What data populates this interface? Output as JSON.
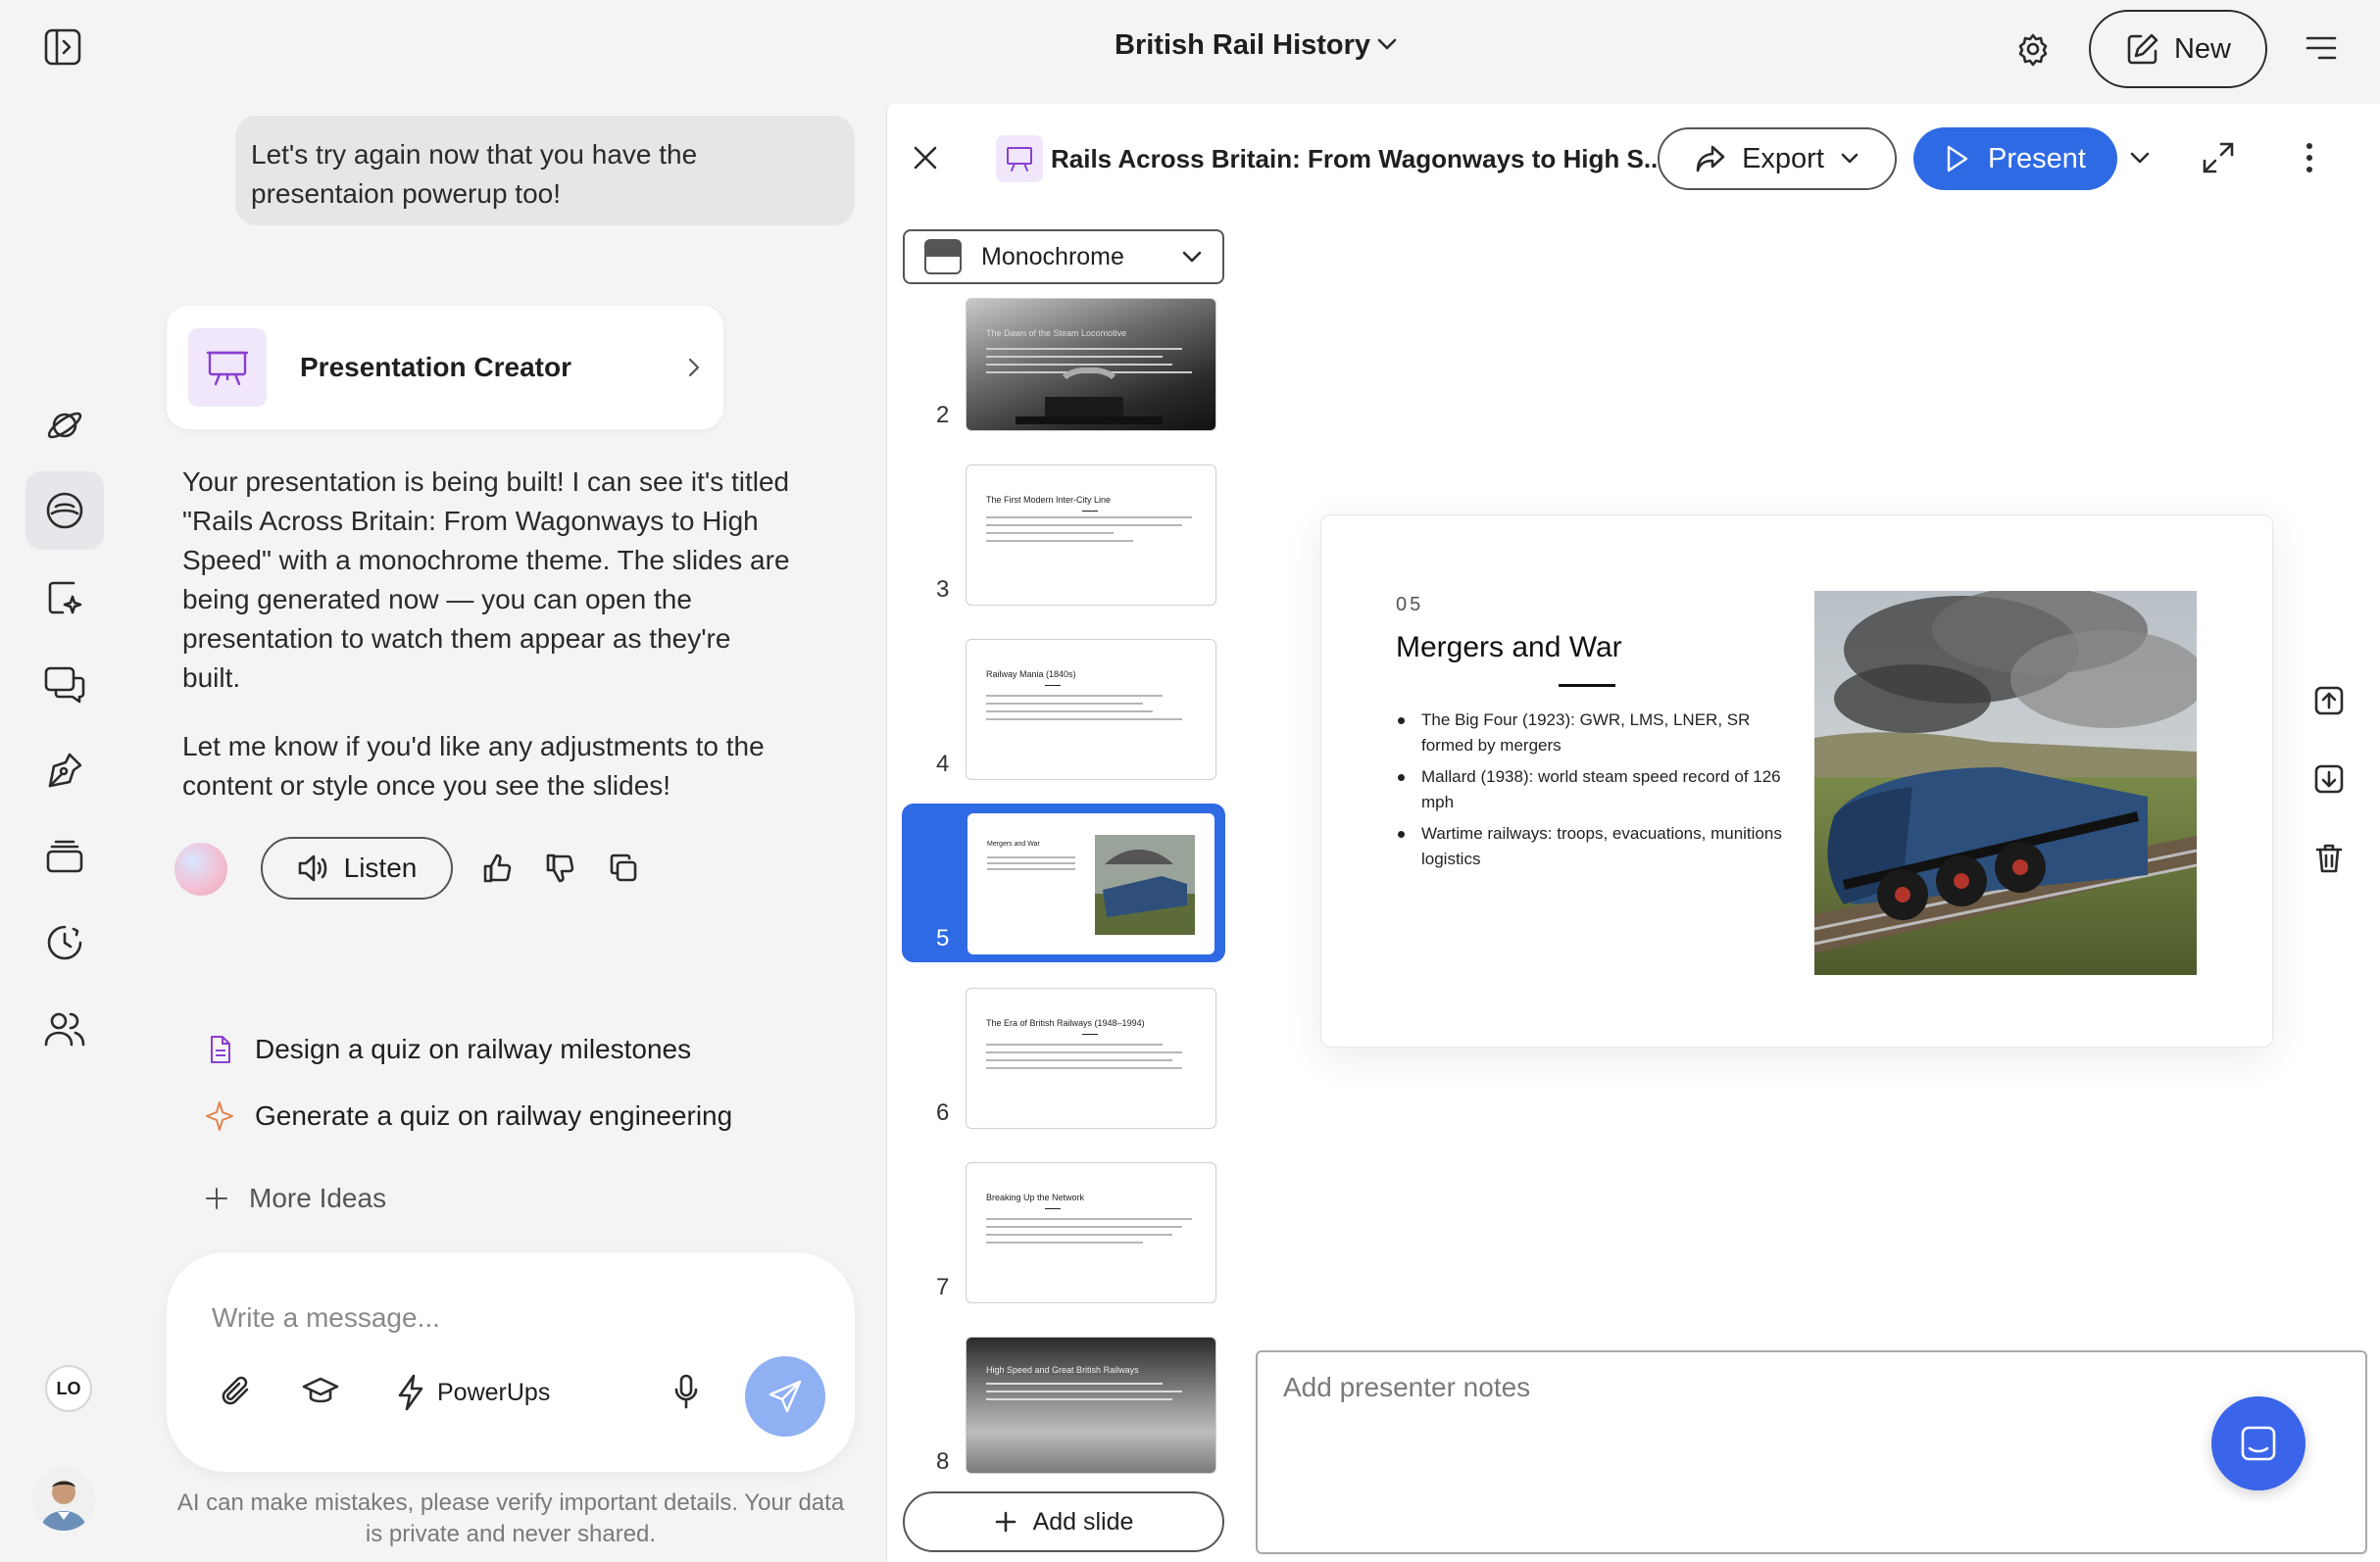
{
  "app": {
    "doc_title": "British Rail History",
    "new_label": "New",
    "user_initials": "LO"
  },
  "chat": {
    "user_message": "Let's try again now that you have the presentaion powerup too!",
    "tool_card_title": "Presentation Creator",
    "assistant_p1": "Your presentation is being built! I can see it's titled \"Rails Across Britain: From Wagonways to High Speed\" with a monochrome theme. The slides are being generated now — you can open the presentation to watch them appear as they're built.",
    "assistant_p2": "Let me know if you'd like any adjustments to the content or style once you see the slides!",
    "listen_label": "Listen",
    "suggestions": [
      {
        "label": "Design a quiz on railway milestones",
        "icon": "document-icon"
      },
      {
        "label": "Generate a quiz on railway engineering",
        "icon": "sparkle-icon"
      }
    ],
    "more_ideas": "More Ideas",
    "composer": {
      "placeholder": "Write a message...",
      "powerups_label": "PowerUps"
    },
    "disclaimer": "AI can make mistakes, please verify important details. Your data is private and never shared."
  },
  "presentation": {
    "title": "Rails Across Britain: From Wagonways to High S...",
    "export_label": "Export",
    "present_label": "Present",
    "theme": "Monochrome",
    "add_slide_label": "Add slide",
    "notes_placeholder": "Add presenter notes",
    "thumbnails": [
      {
        "number": "2",
        "title": "The Dawn of the Steam Locomotive",
        "dark": true
      },
      {
        "number": "3",
        "title": "The First Modern Inter-City Line",
        "dark": false
      },
      {
        "number": "4",
        "title": "Railway Mania (1840s)",
        "dark": false
      },
      {
        "number": "5",
        "title": "Mergers and War",
        "dark": false,
        "selected": true
      },
      {
        "number": "6",
        "title": "The Era of British Railways (1948–1994)",
        "dark": false
      },
      {
        "number": "7",
        "title": "Breaking Up the Network",
        "dark": false
      },
      {
        "number": "8",
        "title": "High Speed and Great British Railways",
        "dark": true
      }
    ],
    "current_slide": {
      "number": "05",
      "title": "Mergers and War",
      "bullets": [
        "The Big Four (1923): GWR, LMS, LNER, SR formed by mergers",
        "Mallard (1938): world steam speed record of 126 mph",
        "Wartime railways: troops, evacuations, munitions logistics"
      ]
    }
  },
  "colors": {
    "accent": "#2f6ae5",
    "send_button": "#8fb0f3",
    "tool_icon_bg": "#f1e7fb",
    "tool_icon": "#8a3fd1",
    "fab": "#3a64ea"
  }
}
